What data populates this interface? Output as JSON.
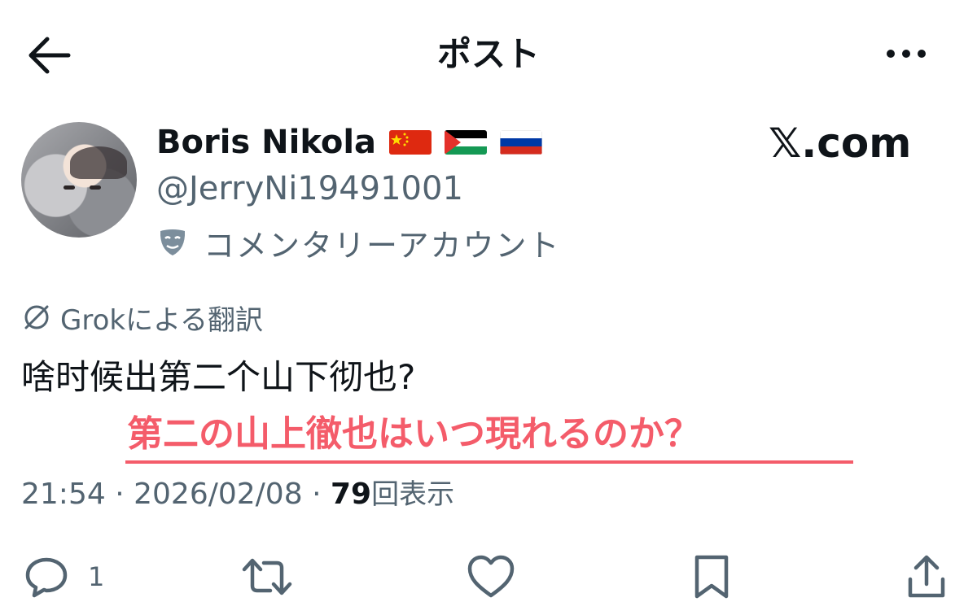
{
  "header": {
    "title": "ポスト"
  },
  "user": {
    "display_name": "Boris Nikola",
    "flags": [
      "china-flag",
      "palestine-flag",
      "russia-flag"
    ],
    "handle": "@JerryNi19491001",
    "commentary_label": "コメンタリーアカウント"
  },
  "watermark": "𝕏.com",
  "post": {
    "translated_by": "Grokによる翻訳",
    "text": "啥时候出第二个山下彻也?",
    "translation_overlay": "第二の山上徹也はいつ現れるのか？",
    "time": "21:54",
    "date": "2026/02/08",
    "separator": "·",
    "views": "79",
    "views_label": "回表示"
  },
  "actions": {
    "reply_count": "1"
  },
  "icons": [
    "back-arrow-icon",
    "more-icon",
    "mask-icon",
    "grok-icon",
    "reply-icon",
    "repost-icon",
    "like-icon",
    "bookmark-icon",
    "share-icon"
  ],
  "colors": {
    "text": "#0f1419",
    "secondary": "#536471",
    "overlay_red": "#f45c6a"
  }
}
